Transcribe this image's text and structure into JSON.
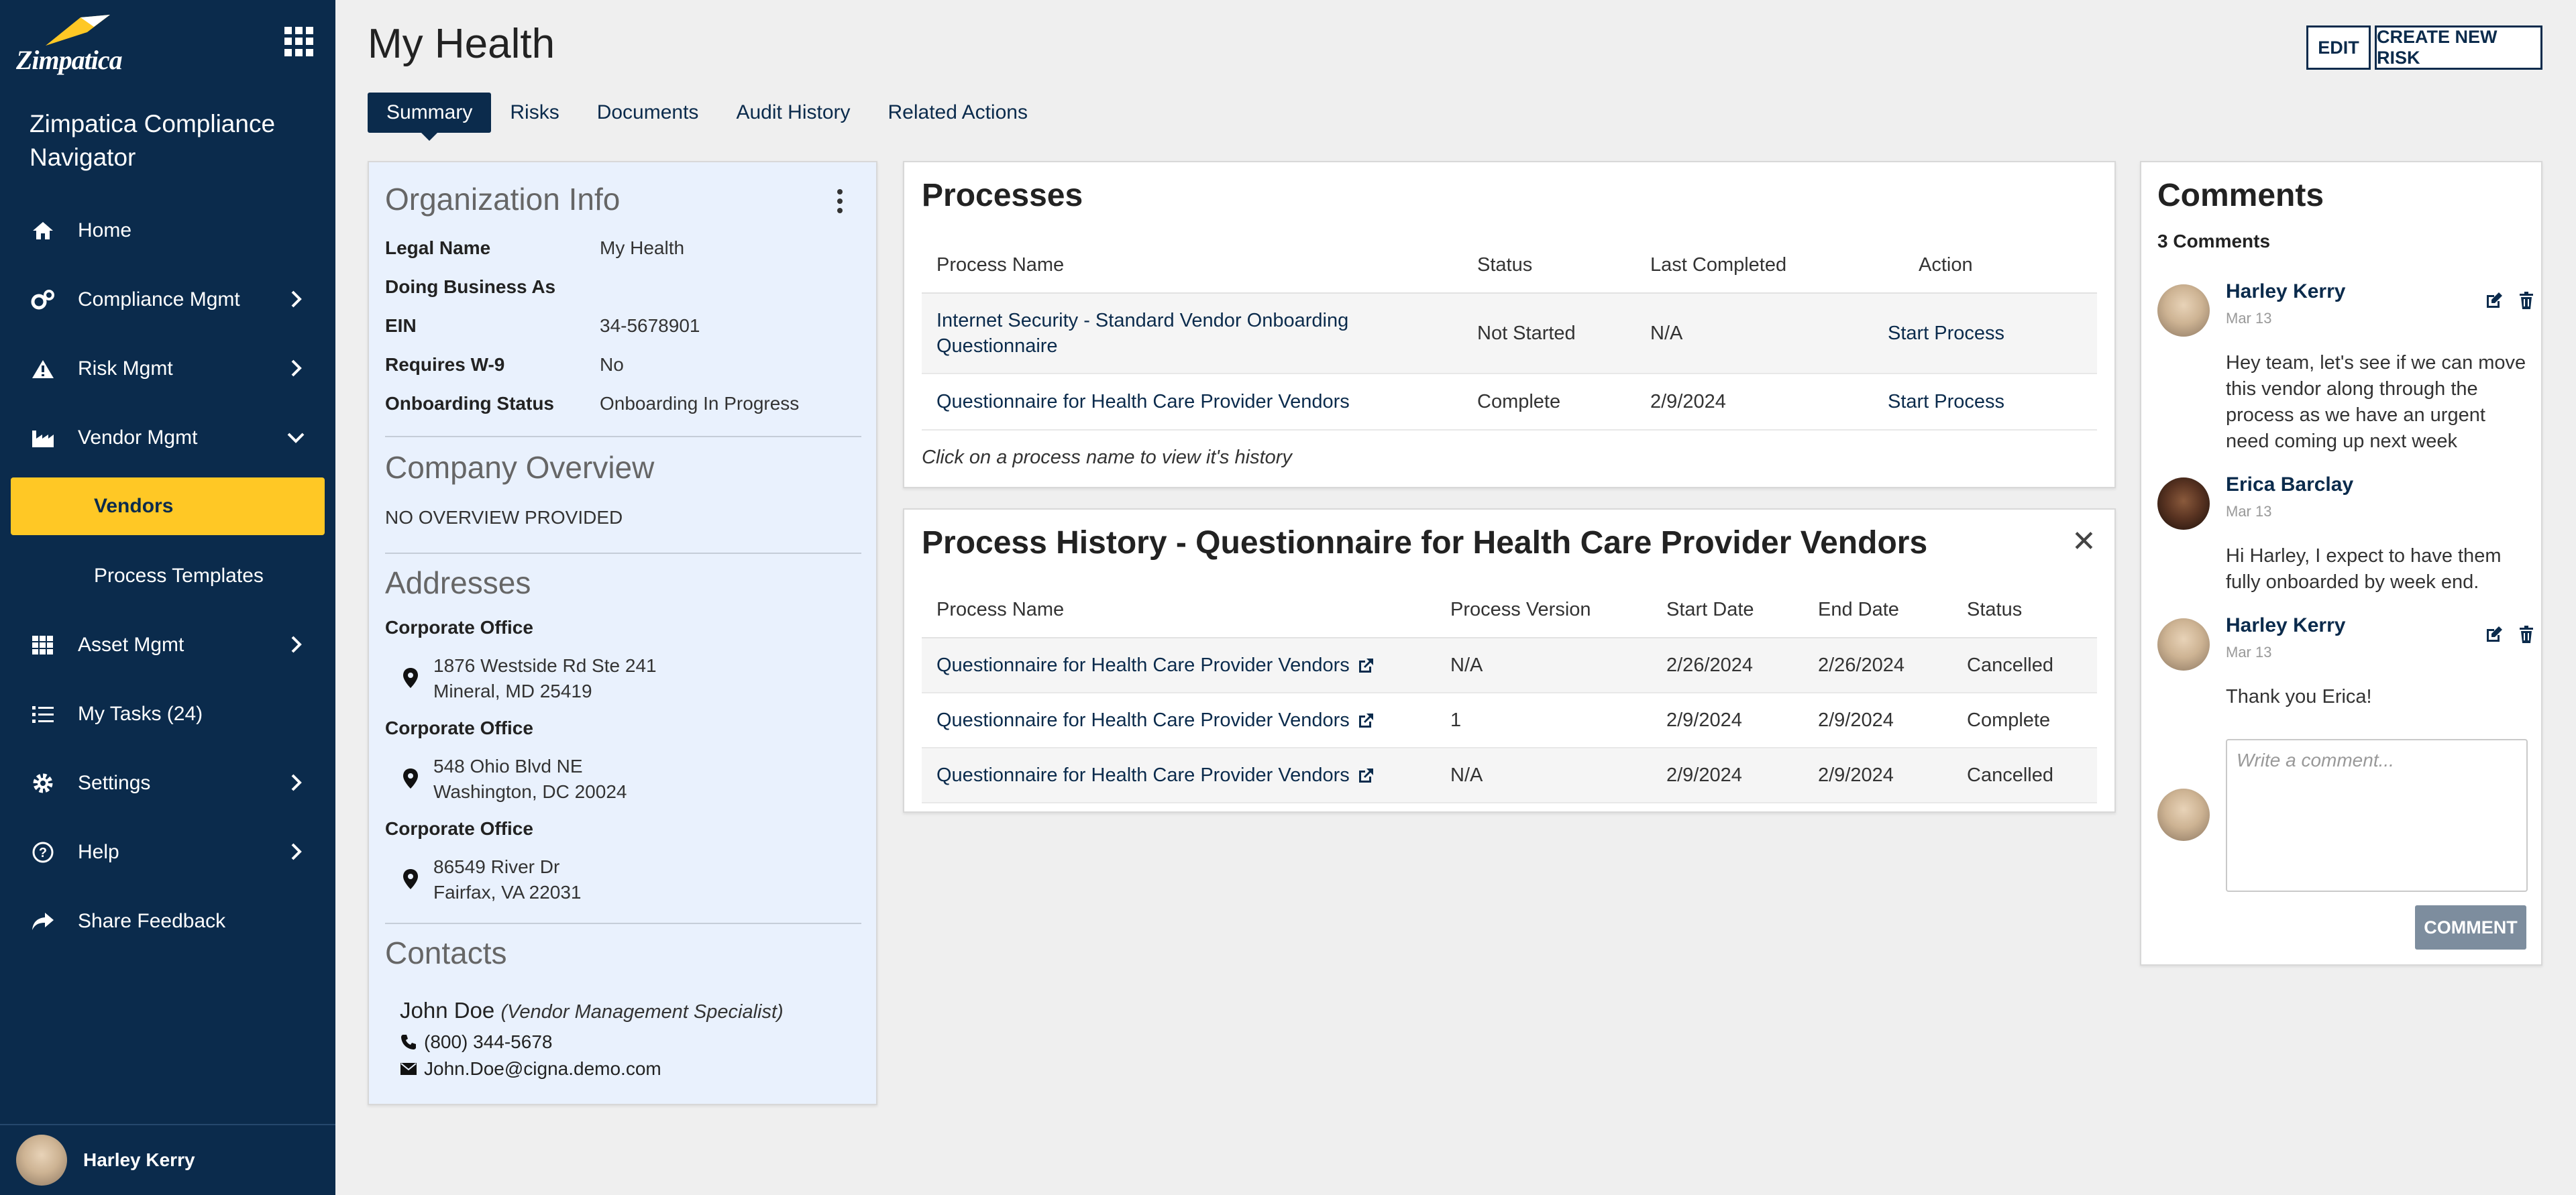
{
  "sidebar": {
    "logo_text": "Zimpatica",
    "app_title": "Zimpatica Compliance Navigator",
    "items": [
      {
        "label": "Home",
        "icon": "home-icon"
      },
      {
        "label": "Compliance Mgmt",
        "icon": "gears-icon"
      },
      {
        "label": "Risk Mgmt",
        "icon": "warning-icon"
      },
      {
        "label": "Vendor Mgmt",
        "icon": "factory-icon"
      },
      {
        "label": "Vendors"
      },
      {
        "label": "Process Templates"
      },
      {
        "label": "Asset Mgmt",
        "icon": "grid-icon"
      },
      {
        "label": "My Tasks (24)",
        "icon": "list-icon"
      },
      {
        "label": "Settings",
        "icon": "gear-icon"
      },
      {
        "label": "Help",
        "icon": "help-icon"
      },
      {
        "label": "Share Feedback",
        "icon": "share-icon"
      }
    ],
    "user_name": "Harley Kerry"
  },
  "header": {
    "title": "My Health",
    "edit_label": "EDIT",
    "create_label": "CREATE NEW RISK",
    "tabs": [
      "Summary",
      "Risks",
      "Documents",
      "Audit History",
      "Related Actions"
    ]
  },
  "org": {
    "title": "Organization Info",
    "fields": [
      {
        "label": "Legal Name",
        "value": "My Health"
      },
      {
        "label": "Doing Business As",
        "value": ""
      },
      {
        "label": "EIN",
        "value": "34-5678901"
      },
      {
        "label": "Requires W-9",
        "value": "No"
      },
      {
        "label": "Onboarding Status",
        "value": "Onboarding In Progress"
      }
    ],
    "overview_title": "Company Overview",
    "overview_text": "NO OVERVIEW PROVIDED",
    "addresses_title": "Addresses",
    "addresses": [
      {
        "label": "Corporate Office",
        "line1": "1876 Westside Rd Ste 241",
        "line2": "Mineral, MD 25419"
      },
      {
        "label": "Corporate Office",
        "line1": "548 Ohio Blvd NE",
        "line2": "Washington, DC 20024"
      },
      {
        "label": "Corporate Office",
        "line1": "86549 River Dr",
        "line2": "Fairfax, VA 22031"
      }
    ],
    "contacts_title": "Contacts",
    "contact": {
      "name": "John Doe",
      "role": "(Vendor Management Specialist)",
      "phone": "(800) 344-5678",
      "email": "John.Doe@cigna.demo.com"
    }
  },
  "processes": {
    "title": "Processes",
    "headers": [
      "Process Name",
      "Status",
      "Last Completed",
      "Action"
    ],
    "rows": [
      {
        "name_line1": "Internet Security - Standard Vendor Onboarding",
        "name_line2": "Questionnaire",
        "status": "Not Started",
        "last": "N/A",
        "action": "Start Process"
      },
      {
        "name_line1": "Questionnaire for Health Care Provider Vendors",
        "name_line2": "",
        "status": "Complete",
        "last": "2/9/2024",
        "action": "Start Process"
      }
    ],
    "note": "Click on a process name to view it's history"
  },
  "history": {
    "title": "Process History - Questionnaire for Health Care Provider Vendors",
    "headers": [
      "Process Name",
      "Process Version",
      "Start Date",
      "End Date",
      "Status"
    ],
    "rows": [
      {
        "name": "Questionnaire for Health Care Provider Vendors",
        "version": "N/A",
        "start": "2/26/2024",
        "end": "2/26/2024",
        "status": "Cancelled"
      },
      {
        "name": "Questionnaire for Health Care Provider Vendors",
        "version": "1",
        "start": "2/9/2024",
        "end": "2/9/2024",
        "status": "Complete"
      },
      {
        "name": "Questionnaire for Health Care Provider Vendors",
        "version": "N/A",
        "start": "2/9/2024",
        "end": "2/9/2024",
        "status": "Cancelled"
      }
    ]
  },
  "comments": {
    "title": "Comments",
    "count_label": "3 Comments",
    "items": [
      {
        "name": "Harley Kerry",
        "date": "Mar 13",
        "lines": [
          "Hey team, let's see if we can move",
          "this vendor along through the",
          "process as we have an urgent",
          "need coming up next week"
        ]
      },
      {
        "name": "Erica Barclay",
        "date": "Mar 13",
        "lines": [
          "Hi Harley, I expect to have them",
          "fully onboarded by week end."
        ]
      },
      {
        "name": "Harley Kerry",
        "date": "Mar 13",
        "lines": [
          "Thank you Erica!"
        ]
      }
    ],
    "placeholder": "Write a comment...",
    "button_label": "COMMENT"
  }
}
